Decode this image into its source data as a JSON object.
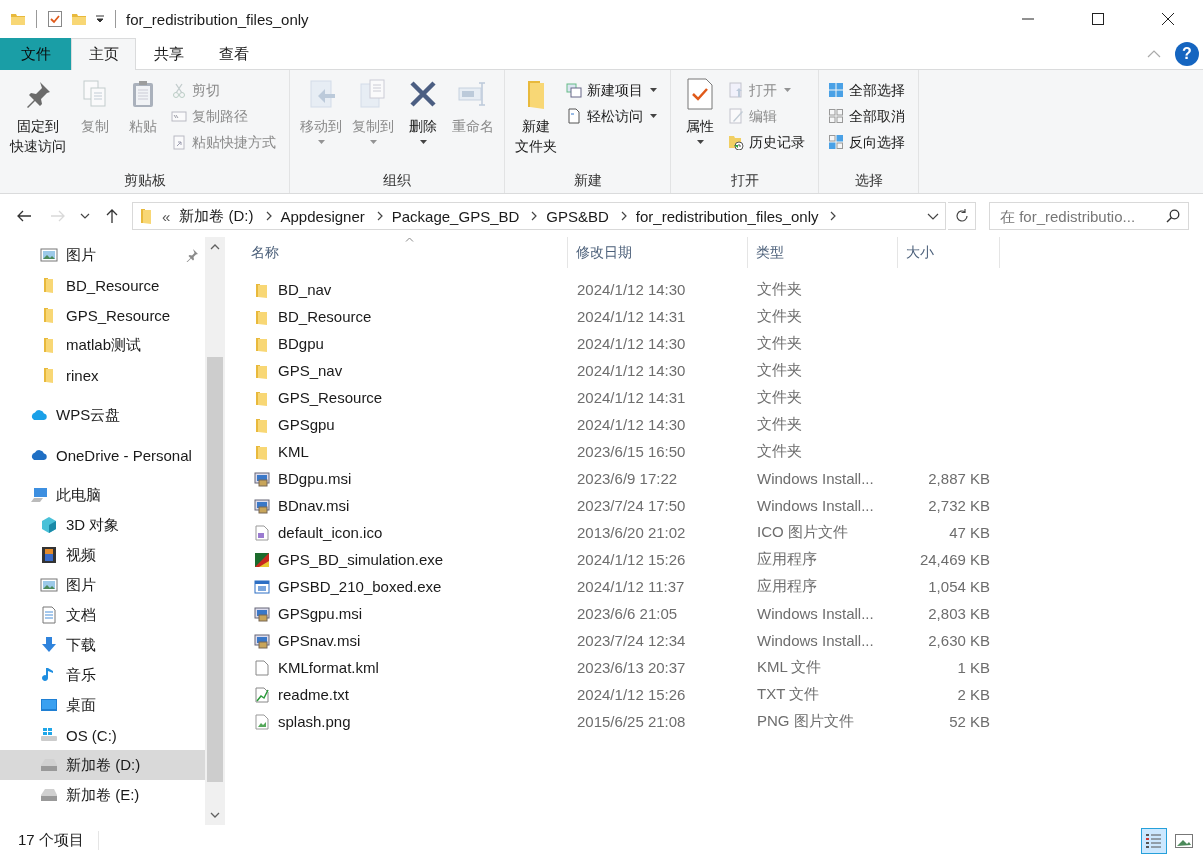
{
  "window": {
    "title": "for_redistribution_files_only"
  },
  "ribbon": {
    "tabs": [
      {
        "label": "文件",
        "kind": "file",
        "selected": false
      },
      {
        "label": "主页",
        "kind": "tab",
        "selected": true
      },
      {
        "label": "共享",
        "kind": "tab",
        "selected": false
      },
      {
        "label": "查看",
        "kind": "tab",
        "selected": false
      }
    ],
    "help": "?",
    "groups": [
      {
        "label": "剪贴板",
        "items": [
          {
            "kind": "large",
            "lines": [
              "固定到",
              "快速访问"
            ],
            "disabled": false,
            "menu": false
          },
          {
            "kind": "large",
            "lines": [
              "复制"
            ],
            "disabled": true,
            "menu": false
          },
          {
            "kind": "large",
            "lines": [
              "粘贴"
            ],
            "disabled": true,
            "menu": false
          },
          {
            "kind": "small",
            "label": "剪切",
            "disabled": true,
            "menu": false
          },
          {
            "kind": "small",
            "label": "复制路径",
            "disabled": true,
            "menu": false
          },
          {
            "kind": "small",
            "label": "粘贴快捷方式",
            "disabled": true,
            "menu": false
          }
        ]
      },
      {
        "label": "组织",
        "items": [
          {
            "kind": "large",
            "lines": [
              "移动到"
            ],
            "disabled": true,
            "menu": true
          },
          {
            "kind": "large",
            "lines": [
              "复制到"
            ],
            "disabled": true,
            "menu": true
          },
          {
            "kind": "large",
            "lines": [
              "删除"
            ],
            "disabled": false,
            "menu": true
          },
          {
            "kind": "large",
            "lines": [
              "重命名"
            ],
            "disabled": true,
            "menu": false
          }
        ]
      },
      {
        "label": "新建",
        "items": [
          {
            "kind": "large",
            "lines": [
              "新建",
              "文件夹"
            ],
            "disabled": false,
            "menu": false
          },
          {
            "kind": "small",
            "label": "新建项目",
            "disabled": false,
            "menu": true
          },
          {
            "kind": "small",
            "label": "轻松访问",
            "disabled": false,
            "menu": true
          }
        ]
      },
      {
        "label": "打开",
        "items": [
          {
            "kind": "large",
            "lines": [
              "属性"
            ],
            "disabled": false,
            "menu": true
          },
          {
            "kind": "small",
            "label": "打开",
            "disabled": true,
            "menu": true
          },
          {
            "kind": "small",
            "label": "编辑",
            "disabled": true,
            "menu": false
          },
          {
            "kind": "small",
            "label": "历史记录",
            "disabled": false,
            "menu": false
          }
        ]
      },
      {
        "label": "选择",
        "items": [
          {
            "kind": "small",
            "label": "全部选择",
            "disabled": false,
            "menu": false
          },
          {
            "kind": "small",
            "label": "全部取消",
            "disabled": false,
            "menu": false
          },
          {
            "kind": "small",
            "label": "反向选择",
            "disabled": false,
            "menu": false
          }
        ]
      }
    ]
  },
  "nav": {
    "back_disabled": false,
    "forward_disabled": true
  },
  "address": {
    "overflow": "«",
    "path": [
      "新加卷 (D:)",
      "Appdesigner",
      "Package_GPS_BD",
      "GPS&BD",
      "for_redistribution_files_only"
    ]
  },
  "search": {
    "placeholder": "在 for_redistributio..."
  },
  "sidebar": {
    "quick_access_items": [
      {
        "label": "图片",
        "kind": "pictures",
        "pinned": true,
        "selected": false
      },
      {
        "label": "BD_Resource",
        "kind": "folder",
        "pinned": false,
        "selected": false
      },
      {
        "label": "GPS_Resource",
        "kind": "folder",
        "pinned": false,
        "selected": false
      },
      {
        "label": "matlab测试",
        "kind": "folder",
        "pinned": false,
        "selected": false
      },
      {
        "label": "rinex",
        "kind": "folder",
        "pinned": false,
        "selected": false
      }
    ],
    "items": [
      {
        "label": "WPS云盘",
        "kind": "wps-cloud",
        "selected": false
      },
      {
        "label": "OneDrive - Personal",
        "kind": "onedrive",
        "selected": false
      },
      {
        "label": "此电脑",
        "kind": "computer",
        "selected": false,
        "children": [
          {
            "label": "3D 对象",
            "kind": "cube",
            "selected": false
          },
          {
            "label": "视频",
            "kind": "video",
            "selected": false
          },
          {
            "label": "图片",
            "kind": "pictures",
            "selected": false
          },
          {
            "label": "文档",
            "kind": "documents",
            "selected": false
          },
          {
            "label": "下载",
            "kind": "download",
            "selected": false
          },
          {
            "label": "音乐",
            "kind": "music",
            "selected": false
          },
          {
            "label": "桌面",
            "kind": "desktop",
            "selected": false
          },
          {
            "label": "OS (C:)",
            "kind": "system-drive",
            "selected": false
          },
          {
            "label": "新加卷 (D:)",
            "kind": "drive",
            "selected": true
          },
          {
            "label": "新加卷 (E:)",
            "kind": "drive",
            "selected": false
          }
        ]
      }
    ]
  },
  "file_list": {
    "columns": [
      {
        "label": "名称",
        "sorted": true
      },
      {
        "label": "修改日期",
        "sorted": false
      },
      {
        "label": "类型",
        "sorted": false
      },
      {
        "label": "大小",
        "sorted": false
      }
    ],
    "rows": [
      {
        "kind": "folder",
        "name": "BD_nav",
        "modified": "2024/1/12 14:30",
        "type": "文件夹"
      },
      {
        "kind": "folder",
        "name": "BD_Resource",
        "modified": "2024/1/12 14:31",
        "type": "文件夹"
      },
      {
        "kind": "folder",
        "name": "BDgpu",
        "modified": "2024/1/12 14:30",
        "type": "文件夹"
      },
      {
        "kind": "folder",
        "name": "GPS_nav",
        "modified": "2024/1/12 14:30",
        "type": "文件夹"
      },
      {
        "kind": "folder",
        "name": "GPS_Resource",
        "modified": "2024/1/12 14:31",
        "type": "文件夹"
      },
      {
        "kind": "folder",
        "name": "GPSgpu",
        "modified": "2024/1/12 14:30",
        "type": "文件夹"
      },
      {
        "kind": "folder",
        "name": "KML",
        "modified": "2023/6/15 16:50",
        "type": "文件夹"
      },
      {
        "kind": "installer",
        "name": "BDgpu.msi",
        "modified": "2023/6/9 17:22",
        "type": "Windows Install...",
        "size": "2,887 KB"
      },
      {
        "kind": "installer",
        "name": "BDnav.msi",
        "modified": "2023/7/24 17:50",
        "type": "Windows Install...",
        "size": "2,732 KB"
      },
      {
        "kind": "icon-file",
        "name": "default_icon.ico",
        "modified": "2013/6/20 21:02",
        "type": "ICO 图片文件",
        "size": "47 KB"
      },
      {
        "kind": "app-colorful",
        "name": "GPS_BD_simulation.exe",
        "modified": "2024/1/12 15:26",
        "type": "应用程序",
        "size": "24,469 KB"
      },
      {
        "kind": "app-window",
        "name": "GPSBD_210_boxed.exe",
        "modified": "2024/1/12 11:37",
        "type": "应用程序",
        "size": "1,054 KB"
      },
      {
        "kind": "installer",
        "name": "GPSgpu.msi",
        "modified": "2023/6/6 21:05",
        "type": "Windows Install...",
        "size": "2,803 KB"
      },
      {
        "kind": "installer",
        "name": "GPSnav.msi",
        "modified": "2023/7/24 12:34",
        "type": "Windows Install...",
        "size": "2,630 KB"
      },
      {
        "kind": "blank-file",
        "name": "KMLformat.kml",
        "modified": "2023/6/13 20:37",
        "type": "KML 文件",
        "size": "1 KB"
      },
      {
        "kind": "text-file",
        "name": "readme.txt",
        "modified": "2024/1/12 15:26",
        "type": "TXT 文件",
        "size": "2 KB"
      },
      {
        "kind": "image-file",
        "name": "splash.png",
        "modified": "2015/6/25 21:08",
        "type": "PNG 图片文件",
        "size": "52 KB"
      }
    ]
  },
  "status_bar": {
    "item_count": "17 个项目",
    "views": [
      {
        "kind": "details",
        "selected": true
      },
      {
        "kind": "large-icons",
        "selected": false
      }
    ]
  }
}
